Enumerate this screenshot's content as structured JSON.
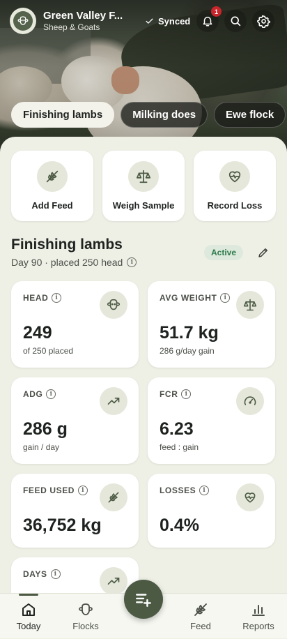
{
  "header": {
    "farm_name": "Green Valley F...",
    "farm_type": "Sheep & Goats",
    "sync_status": "Synced",
    "notification_count": "1",
    "icons": [
      "bell-icon",
      "search-icon",
      "gear-icon"
    ]
  },
  "tabs": [
    {
      "label": "Finishing lambs",
      "active": true
    },
    {
      "label": "Milking does",
      "active": false
    },
    {
      "label": "Ewe flock",
      "active": false
    }
  ],
  "quick_actions": [
    {
      "label": "Add Feed",
      "icon": "feed-icon"
    },
    {
      "label": "Weigh Sample",
      "icon": "scale-icon"
    },
    {
      "label": "Record Loss",
      "icon": "heart-pulse-icon"
    }
  ],
  "group": {
    "title": "Finishing lambs",
    "subtitle": "Day 90 · placed 250 head",
    "status": "Active"
  },
  "metrics": [
    {
      "label": "HEAD",
      "value": "249",
      "sub": "of 250 placed",
      "icon": "sheep-icon"
    },
    {
      "label": "AVG WEIGHT",
      "value": "51.7 kg",
      "sub": "286 g/day gain",
      "icon": "scale-icon"
    },
    {
      "label": "ADG",
      "value": "286 g",
      "sub": "gain / day",
      "icon": "trend-up-icon"
    },
    {
      "label": "FCR",
      "value": "6.23",
      "sub": "feed : gain",
      "icon": "gauge-icon"
    },
    {
      "label": "FEED USED",
      "value": "36,752 kg",
      "sub": "",
      "icon": "feed-icon"
    },
    {
      "label": "LOSSES",
      "value": "0.4%",
      "sub": "",
      "icon": "heart-pulse-icon"
    },
    {
      "label": "DAYS",
      "value": "",
      "sub": "",
      "icon": "trend-up-icon"
    }
  ],
  "bottom_nav": [
    {
      "label": "Today",
      "active": true
    },
    {
      "label": "Flocks",
      "active": false
    },
    {
      "label": "Feed",
      "active": false
    },
    {
      "label": "Reports",
      "active": false
    }
  ],
  "colors": {
    "accent": "#4c5a44",
    "background": "#eef0e6",
    "badge": "#c8262b",
    "status_green": "#2e7a4c"
  }
}
